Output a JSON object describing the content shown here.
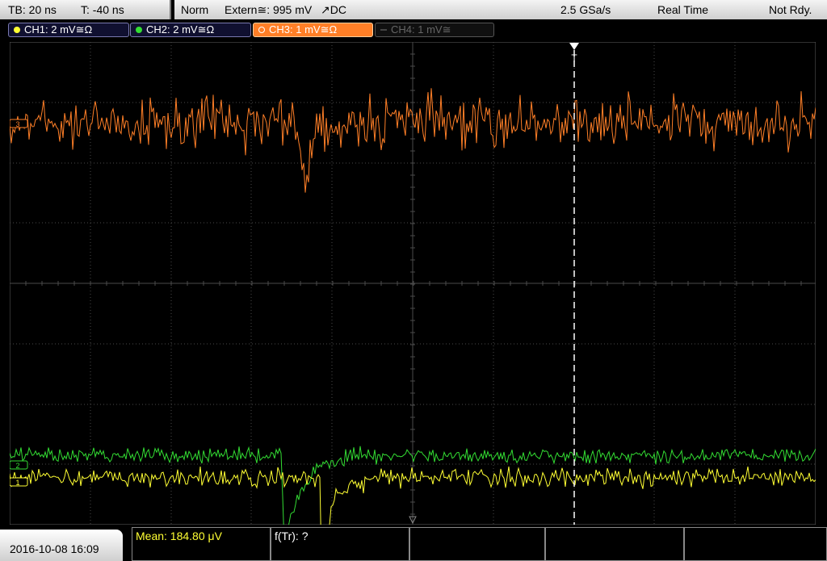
{
  "timebase": {
    "tb": "TB: 20 ns",
    "t": "T: -40 ns"
  },
  "trigger": {
    "mode": "Norm",
    "source": "Extern≅: 995 mV",
    "slope": "↗DC"
  },
  "acquisition": {
    "rate": "2.5 GSa/s",
    "mode": "Real Time",
    "status": "Not Rdy."
  },
  "channels": [
    {
      "label": "CH1: 2 mV≅Ω",
      "color": "#ffff33",
      "state": "off"
    },
    {
      "label": "CH2: 2 mV≅Ω",
      "color": "#33dd33",
      "state": "off"
    },
    {
      "label": "CH3: 1 mV≅Ω",
      "color": "#ff7f27",
      "state": "active"
    },
    {
      "label": "CH4: 1 mV≅",
      "color": "#777777",
      "state": "disabled"
    }
  ],
  "markers": {
    "trigger": "T",
    "ch1": "1",
    "ch2": "2",
    "ch3": "3"
  },
  "datetime": "2016-10-08 16:09",
  "measurements": {
    "mean": "Mean: 184.80 μV",
    "ftr": "f(Tr): ?"
  },
  "colors": {
    "ch1": "#ffff33",
    "ch2": "#33dd33",
    "ch3": "#ff7f27",
    "grid": "#555555"
  }
}
